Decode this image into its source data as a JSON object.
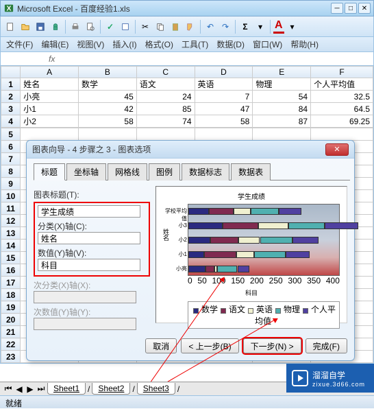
{
  "app": {
    "title": "Microsoft Excel - 百度经验1.xls"
  },
  "menubar": {
    "file": "文件(F)",
    "edit": "编辑(E)",
    "view": "视图(V)",
    "insert": "插入(I)",
    "format": "格式(O)",
    "tools": "工具(T)",
    "data": "数据(D)",
    "window": "窗口(W)",
    "help": "帮助(H)"
  },
  "columns": [
    "A",
    "B",
    "C",
    "D",
    "E",
    "F"
  ],
  "headers": [
    "姓名",
    "数学",
    "语文",
    "英语",
    "物理",
    "个人平均值"
  ],
  "rows": [
    {
      "name": "小亮",
      "math": 45,
      "chinese": 24,
      "english": 7,
      "physics": 54,
      "avg": 32.5
    },
    {
      "name": "小1",
      "math": 42,
      "chinese": 85,
      "english": 47,
      "physics": 84,
      "avg": 64.5
    },
    {
      "name": "小2",
      "math": 58,
      "chinese": 74,
      "english": 58,
      "physics": 87,
      "avg": 69.25
    }
  ],
  "row_numbers_tail": [
    5,
    6,
    7,
    8,
    9,
    10,
    11,
    12,
    13,
    14,
    15,
    16,
    17,
    18,
    19,
    20,
    21,
    22,
    23
  ],
  "dialog": {
    "title": "图表向导 - 4 步骤之 3 - 图表选项",
    "tabs": [
      "标题",
      "坐标轴",
      "网格线",
      "图例",
      "数据标志",
      "数据表"
    ],
    "form": {
      "chart_title_label": "图表标题(T):",
      "chart_title": "学生成绩",
      "x_axis_label": "分类(X)轴(C):",
      "x_axis": "姓名",
      "y_axis_label": "数值(Y)轴(V):",
      "y_axis": "科目",
      "x2_label": "次分类(X)轴(X):",
      "y2_label": "次数值(Y)轴(Y):"
    },
    "buttons": {
      "cancel": "取消",
      "back": "< 上一步(B)",
      "next": "下一步(N) >",
      "finish": "完成(F)"
    }
  },
  "chart_data": {
    "type": "bar",
    "title": "学生成绩",
    "xlabel": "科目",
    "ylabel": "姓名",
    "categories": [
      "小亮",
      "小1",
      "小2",
      "小3",
      "学校平均值"
    ],
    "series": [
      {
        "name": "数学",
        "values": [
          45,
          42,
          58,
          90,
          55
        ],
        "color": "#2a2a80"
      },
      {
        "name": "语文",
        "values": [
          24,
          85,
          74,
          95,
          65
        ],
        "color": "#802a50"
      },
      {
        "name": "英语",
        "values": [
          7,
          47,
          58,
          80,
          45
        ],
        "color": "#f0f0d0"
      },
      {
        "name": "物理",
        "values": [
          54,
          84,
          87,
          96,
          75
        ],
        "color": "#50b0b0"
      },
      {
        "name": "个人平均值",
        "values": [
          32.5,
          64.5,
          69.25,
          90.25,
          60
        ],
        "color": "#5040a0"
      }
    ],
    "xlim": [
      0,
      400
    ],
    "xticks": [
      0,
      50,
      100,
      150,
      200,
      250,
      300,
      350,
      400
    ]
  },
  "sheets": [
    "Sheet1",
    "Sheet2",
    "Sheet3"
  ],
  "status": "就绪",
  "watermark": {
    "brand": "溜溜自学",
    "url": "zixue.3d66.com"
  }
}
